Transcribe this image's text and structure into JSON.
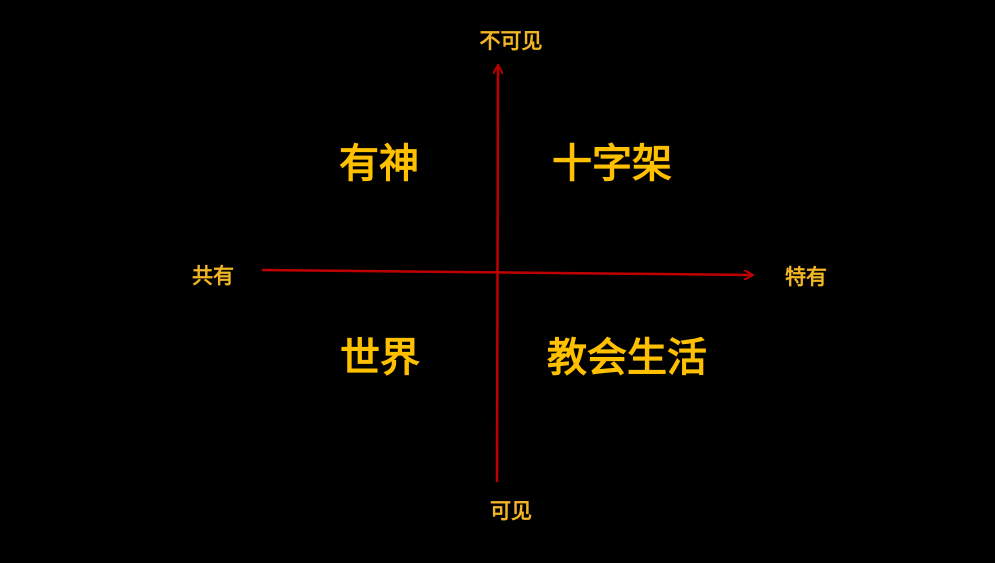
{
  "axes": {
    "top": "不可见",
    "bottom": "可见",
    "left": "共有",
    "right": "特有"
  },
  "quadrants": {
    "top_left": "有神",
    "top_right": "十字架",
    "bottom_left": "世界",
    "bottom_right": "教会生活"
  },
  "colors": {
    "background": "#000000",
    "axis": "#C00000",
    "text": "#FFC000"
  }
}
